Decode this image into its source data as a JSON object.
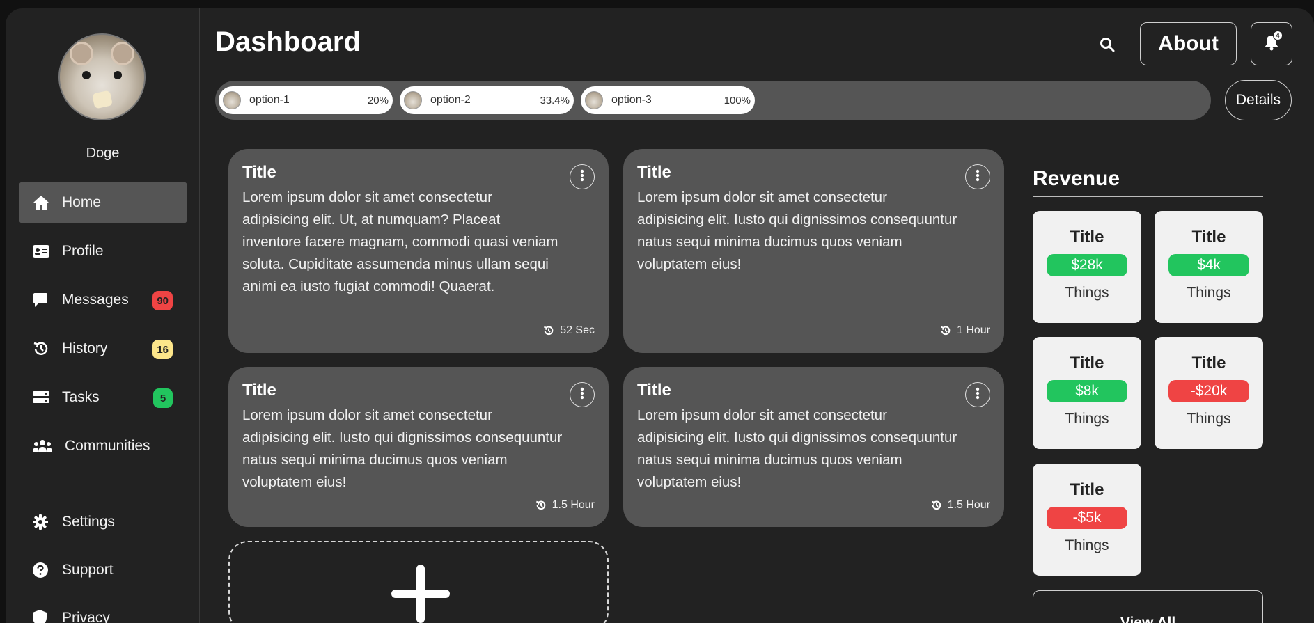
{
  "user": {
    "name": "Doge"
  },
  "sidebar": {
    "items": [
      {
        "label": "Home",
        "icon": "home-icon"
      },
      {
        "label": "Profile",
        "icon": "id-card-icon"
      },
      {
        "label": "Messages",
        "icon": "message-icon",
        "badge": "90",
        "badge_color": "#ef4444",
        "badge_text_color": "#222222"
      },
      {
        "label": "History",
        "icon": "history-icon",
        "badge": "16",
        "badge_color": "#fde68a",
        "badge_text_color": "#222222"
      },
      {
        "label": "Tasks",
        "icon": "tasks-icon",
        "badge": "5",
        "badge_color": "#22c55e",
        "badge_text_color": "#222222"
      },
      {
        "label": "Communities",
        "icon": "users-icon"
      }
    ],
    "bottom_items": [
      {
        "label": "Settings",
        "icon": "gear-icon"
      },
      {
        "label": "Support",
        "icon": "question-icon"
      },
      {
        "label": "Privacy",
        "icon": "shield-icon"
      }
    ]
  },
  "header": {
    "title": "Dashboard",
    "about_label": "About",
    "notification_count": "4"
  },
  "options": [
    {
      "label": "option-1",
      "percent": "20%"
    },
    {
      "label": "option-2",
      "percent": "33.4%"
    },
    {
      "label": "option-3",
      "percent": "100%"
    }
  ],
  "details_label": "Details",
  "cards": [
    {
      "title": "Title",
      "body": "Lorem ipsum dolor sit amet consectetur adipisicing elit. Ut, at numquam? Placeat inventore facere magnam, commodi quasi veniam soluta. Cupiditate assumenda minus ullam sequi animi ea iusto fugiat commodi! Quaerat.",
      "time": "52 Sec"
    },
    {
      "title": "Title",
      "body": "Lorem ipsum dolor sit amet consectetur adipisicing elit. Iusto qui dignissimos consequuntur natus sequi minima ducimus quos veniam voluptatem eius!",
      "time": "1 Hour"
    },
    {
      "title": "Title",
      "body": "Lorem ipsum dolor sit amet consectetur adipisicing elit. Iusto qui dignissimos consequuntur natus sequi minima ducimus quos veniam voluptatem eius!",
      "time": "1.5 Hour"
    },
    {
      "title": "Title",
      "body": "Lorem ipsum dolor sit amet consectetur adipisicing elit. Iusto qui dignissimos consequuntur natus sequi minima ducimus quos veniam voluptatem eius!",
      "time": "1.5 Hour"
    }
  ],
  "revenue": {
    "title": "Revenue",
    "items": [
      {
        "title": "Title",
        "value": "$28k",
        "label": "Things",
        "color": "#22c55e"
      },
      {
        "title": "Title",
        "value": "$4k",
        "label": "Things",
        "color": "#22c55e"
      },
      {
        "title": "Title",
        "value": "$8k",
        "label": "Things",
        "color": "#22c55e"
      },
      {
        "title": "Title",
        "value": "-$20k",
        "label": "Things",
        "color": "#ef4444"
      },
      {
        "title": "Title",
        "value": "-$5k",
        "label": "Things",
        "color": "#ef4444"
      }
    ],
    "view_all_label": "View All"
  }
}
